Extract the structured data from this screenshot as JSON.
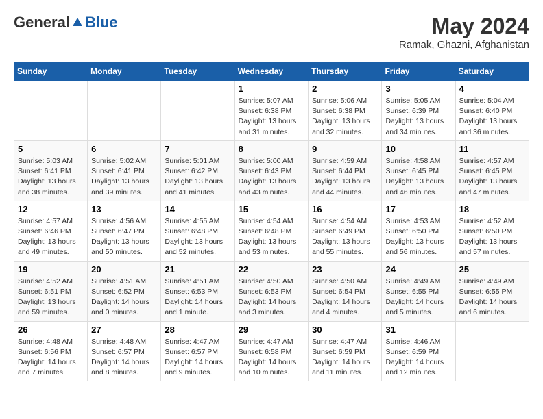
{
  "logo": {
    "general": "General",
    "blue": "Blue"
  },
  "title": "May 2024",
  "location": "Ramak, Ghazni, Afghanistan",
  "days_of_week": [
    "Sunday",
    "Monday",
    "Tuesday",
    "Wednesday",
    "Thursday",
    "Friday",
    "Saturday"
  ],
  "weeks": [
    [
      {
        "day": "",
        "info": ""
      },
      {
        "day": "",
        "info": ""
      },
      {
        "day": "",
        "info": ""
      },
      {
        "day": "1",
        "info": "Sunrise: 5:07 AM\nSunset: 6:38 PM\nDaylight: 13 hours\nand 31 minutes."
      },
      {
        "day": "2",
        "info": "Sunrise: 5:06 AM\nSunset: 6:38 PM\nDaylight: 13 hours\nand 32 minutes."
      },
      {
        "day": "3",
        "info": "Sunrise: 5:05 AM\nSunset: 6:39 PM\nDaylight: 13 hours\nand 34 minutes."
      },
      {
        "day": "4",
        "info": "Sunrise: 5:04 AM\nSunset: 6:40 PM\nDaylight: 13 hours\nand 36 minutes."
      }
    ],
    [
      {
        "day": "5",
        "info": "Sunrise: 5:03 AM\nSunset: 6:41 PM\nDaylight: 13 hours\nand 38 minutes."
      },
      {
        "day": "6",
        "info": "Sunrise: 5:02 AM\nSunset: 6:41 PM\nDaylight: 13 hours\nand 39 minutes."
      },
      {
        "day": "7",
        "info": "Sunrise: 5:01 AM\nSunset: 6:42 PM\nDaylight: 13 hours\nand 41 minutes."
      },
      {
        "day": "8",
        "info": "Sunrise: 5:00 AM\nSunset: 6:43 PM\nDaylight: 13 hours\nand 43 minutes."
      },
      {
        "day": "9",
        "info": "Sunrise: 4:59 AM\nSunset: 6:44 PM\nDaylight: 13 hours\nand 44 minutes."
      },
      {
        "day": "10",
        "info": "Sunrise: 4:58 AM\nSunset: 6:45 PM\nDaylight: 13 hours\nand 46 minutes."
      },
      {
        "day": "11",
        "info": "Sunrise: 4:57 AM\nSunset: 6:45 PM\nDaylight: 13 hours\nand 47 minutes."
      }
    ],
    [
      {
        "day": "12",
        "info": "Sunrise: 4:57 AM\nSunset: 6:46 PM\nDaylight: 13 hours\nand 49 minutes."
      },
      {
        "day": "13",
        "info": "Sunrise: 4:56 AM\nSunset: 6:47 PM\nDaylight: 13 hours\nand 50 minutes."
      },
      {
        "day": "14",
        "info": "Sunrise: 4:55 AM\nSunset: 6:48 PM\nDaylight: 13 hours\nand 52 minutes."
      },
      {
        "day": "15",
        "info": "Sunrise: 4:54 AM\nSunset: 6:48 PM\nDaylight: 13 hours\nand 53 minutes."
      },
      {
        "day": "16",
        "info": "Sunrise: 4:54 AM\nSunset: 6:49 PM\nDaylight: 13 hours\nand 55 minutes."
      },
      {
        "day": "17",
        "info": "Sunrise: 4:53 AM\nSunset: 6:50 PM\nDaylight: 13 hours\nand 56 minutes."
      },
      {
        "day": "18",
        "info": "Sunrise: 4:52 AM\nSunset: 6:50 PM\nDaylight: 13 hours\nand 57 minutes."
      }
    ],
    [
      {
        "day": "19",
        "info": "Sunrise: 4:52 AM\nSunset: 6:51 PM\nDaylight: 13 hours\nand 59 minutes."
      },
      {
        "day": "20",
        "info": "Sunrise: 4:51 AM\nSunset: 6:52 PM\nDaylight: 14 hours\nand 0 minutes."
      },
      {
        "day": "21",
        "info": "Sunrise: 4:51 AM\nSunset: 6:53 PM\nDaylight: 14 hours\nand 1 minute."
      },
      {
        "day": "22",
        "info": "Sunrise: 4:50 AM\nSunset: 6:53 PM\nDaylight: 14 hours\nand 3 minutes."
      },
      {
        "day": "23",
        "info": "Sunrise: 4:50 AM\nSunset: 6:54 PM\nDaylight: 14 hours\nand 4 minutes."
      },
      {
        "day": "24",
        "info": "Sunrise: 4:49 AM\nSunset: 6:55 PM\nDaylight: 14 hours\nand 5 minutes."
      },
      {
        "day": "25",
        "info": "Sunrise: 4:49 AM\nSunset: 6:55 PM\nDaylight: 14 hours\nand 6 minutes."
      }
    ],
    [
      {
        "day": "26",
        "info": "Sunrise: 4:48 AM\nSunset: 6:56 PM\nDaylight: 14 hours\nand 7 minutes."
      },
      {
        "day": "27",
        "info": "Sunrise: 4:48 AM\nSunset: 6:57 PM\nDaylight: 14 hours\nand 8 minutes."
      },
      {
        "day": "28",
        "info": "Sunrise: 4:47 AM\nSunset: 6:57 PM\nDaylight: 14 hours\nand 9 minutes."
      },
      {
        "day": "29",
        "info": "Sunrise: 4:47 AM\nSunset: 6:58 PM\nDaylight: 14 hours\nand 10 minutes."
      },
      {
        "day": "30",
        "info": "Sunrise: 4:47 AM\nSunset: 6:59 PM\nDaylight: 14 hours\nand 11 minutes."
      },
      {
        "day": "31",
        "info": "Sunrise: 4:46 AM\nSunset: 6:59 PM\nDaylight: 14 hours\nand 12 minutes."
      },
      {
        "day": "",
        "info": ""
      }
    ]
  ]
}
